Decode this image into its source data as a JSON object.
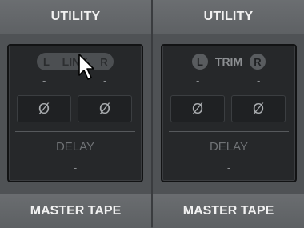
{
  "strips": [
    {
      "header": "UTILITY",
      "footer": "MASTER TAPE",
      "toggle": {
        "left": "L",
        "center": "LINK",
        "right": "R"
      },
      "left_value": "-",
      "right_value": "-",
      "phase_left": "Ø",
      "phase_right": "Ø",
      "delay_label": "DELAY",
      "delay_value": "-"
    },
    {
      "header": "UTILITY",
      "footer": "MASTER TAPE",
      "toggle": {
        "left": "L",
        "center": "TRIM",
        "right": "R"
      },
      "left_value": "-",
      "right_value": "-",
      "phase_left": "Ø",
      "phase_right": "Ø",
      "delay_label": "DELAY",
      "delay_value": "-"
    }
  ],
  "icons": {
    "cursor": "mouse-pointer-icon"
  }
}
